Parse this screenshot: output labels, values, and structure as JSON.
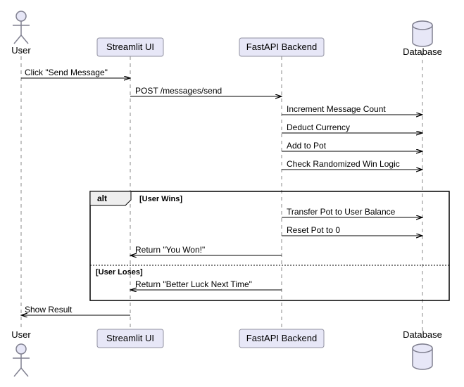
{
  "participants": {
    "user": "User",
    "ui": "Streamlit UI",
    "api": "FastAPI Backend",
    "db": "Database"
  },
  "messages": {
    "m1": "Click \"Send Message\"",
    "m2": "POST /messages/send",
    "m3": "Increment Message Count",
    "m4": "Deduct Currency",
    "m5": "Add to Pot",
    "m6": "Check Randomized Win Logic",
    "m7": "Transfer Pot to User Balance",
    "m8": "Reset Pot to 0",
    "m9": "Return \"You Won!\"",
    "m10": "Return \"Better Luck Next Time\"",
    "m11": "Show Result"
  },
  "fragment": {
    "operator": "alt",
    "guard_win": "[User Wins]",
    "guard_lose": "[User Loses]"
  },
  "chart_data": {
    "type": "sequence-diagram",
    "participants": [
      {
        "id": "user",
        "name": "User",
        "kind": "actor"
      },
      {
        "id": "ui",
        "name": "Streamlit UI",
        "kind": "participant"
      },
      {
        "id": "api",
        "name": "FastAPI Backend",
        "kind": "participant"
      },
      {
        "id": "db",
        "name": "Database",
        "kind": "database"
      }
    ],
    "messages": [
      {
        "from": "user",
        "to": "ui",
        "label": "Click \"Send Message\""
      },
      {
        "from": "ui",
        "to": "api",
        "label": "POST /messages/send"
      },
      {
        "from": "api",
        "to": "db",
        "label": "Increment Message Count"
      },
      {
        "from": "api",
        "to": "db",
        "label": "Deduct Currency"
      },
      {
        "from": "api",
        "to": "db",
        "label": "Add to Pot"
      },
      {
        "from": "api",
        "to": "db",
        "label": "Check Randomized Win Logic"
      },
      {
        "fragment": "alt",
        "branches": [
          {
            "guard": "[User Wins]",
            "messages": [
              {
                "from": "api",
                "to": "db",
                "label": "Transfer Pot to User Balance"
              },
              {
                "from": "api",
                "to": "db",
                "label": "Reset Pot to 0"
              },
              {
                "from": "api",
                "to": "ui",
                "label": "Return \"You Won!\""
              }
            ]
          },
          {
            "guard": "[User Loses]",
            "messages": [
              {
                "from": "api",
                "to": "ui",
                "label": "Return \"Better Luck Next Time\""
              }
            ]
          }
        ]
      },
      {
        "from": "ui",
        "to": "user",
        "label": "Show Result"
      }
    ]
  }
}
